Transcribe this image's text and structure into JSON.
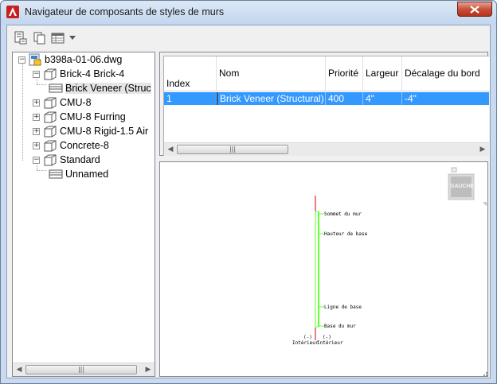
{
  "window": {
    "title": "Navigateur de composants de styles de murs"
  },
  "toolbar": {
    "buttons": [
      "new-component-icon",
      "copy-icon",
      "table-view-icon"
    ]
  },
  "tree": {
    "root": "b398a-01-06.dwg",
    "items": [
      {
        "label": "Brick-4 Brick-4",
        "expanded": true
      },
      {
        "label": "Brick Veneer (Struc",
        "child": true,
        "selected": true
      },
      {
        "label": "CMU-8"
      },
      {
        "label": "CMU-8 Furring"
      },
      {
        "label": "CMU-8 Rigid-1.5 Air"
      },
      {
        "label": "Concrete-8"
      },
      {
        "label": "Standard",
        "expanded": true
      },
      {
        "label": "Unnamed",
        "child": true
      }
    ]
  },
  "grid": {
    "columns": [
      "Index",
      "Nom",
      "Priorité",
      "Largeur",
      "Décalage du bord"
    ],
    "rows": [
      [
        "1",
        "Brick Veneer (Structural)",
        "400",
        "4\"",
        "-4\""
      ]
    ]
  },
  "preview": {
    "viewcube_label": "GAUCHE",
    "labels": {
      "top": "Sommet du mur",
      "height": "Hauteur de base",
      "baseline": "Ligne de base",
      "bottom": "Base du mur",
      "exterior": "Intérieur",
      "interior": "Intérieur",
      "marker_left": "(-)",
      "marker_right": "(-)"
    },
    "wall_color": "#66ff33",
    "axis_color": "#cc0000"
  },
  "colors": {
    "selection": "#3399ff",
    "close_button": "#c9503a"
  }
}
